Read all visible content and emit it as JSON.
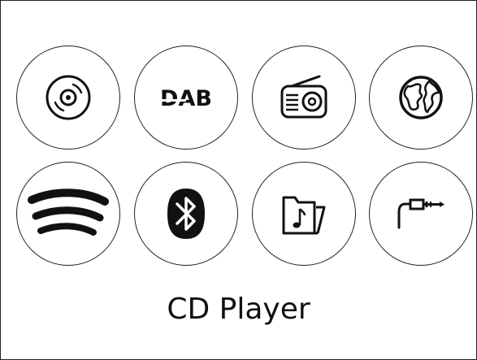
{
  "sources": [
    {
      "id": "cd",
      "icon": "cd-icon"
    },
    {
      "id": "dab",
      "icon": "dab-icon",
      "text": "DAB"
    },
    {
      "id": "radio",
      "icon": "radio-icon"
    },
    {
      "id": "internet-radio",
      "icon": "globe-icon"
    },
    {
      "id": "spotify",
      "icon": "spotify-icon"
    },
    {
      "id": "bluetooth",
      "icon": "bluetooth-icon"
    },
    {
      "id": "music-folder",
      "icon": "music-folder-icon"
    },
    {
      "id": "aux",
      "icon": "aux-jack-icon"
    }
  ],
  "selected_source_label": "CD Player"
}
